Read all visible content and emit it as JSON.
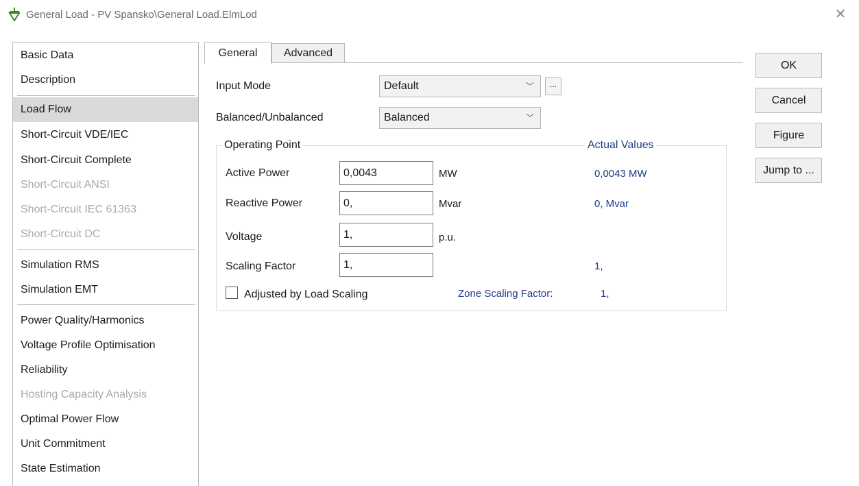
{
  "window": {
    "title": "General Load - PV Spansko\\General Load.ElmLod",
    "close_glyph": "✕",
    "icon": "load-arrow-icon",
    "icon_color": "#3a8a2a"
  },
  "nav": {
    "items": [
      {
        "label": "Basic Data",
        "state": "normal"
      },
      {
        "label": "Description",
        "state": "normal"
      },
      {
        "label": "Load Flow",
        "state": "selected"
      },
      {
        "label": "Short-Circuit VDE/IEC",
        "state": "normal"
      },
      {
        "label": "Short-Circuit Complete",
        "state": "normal"
      },
      {
        "label": "Short-Circuit ANSI",
        "state": "disabled"
      },
      {
        "label": "Short-Circuit IEC 61363",
        "state": "disabled"
      },
      {
        "label": "Short-Circuit DC",
        "state": "disabled"
      },
      {
        "label": "Simulation RMS",
        "state": "normal"
      },
      {
        "label": "Simulation EMT",
        "state": "normal"
      },
      {
        "label": "Power Quality/Harmonics",
        "state": "normal"
      },
      {
        "label": "Voltage Profile Optimisation",
        "state": "normal"
      },
      {
        "label": "Reliability",
        "state": "normal"
      },
      {
        "label": "Hosting Capacity Analysis",
        "state": "disabled"
      },
      {
        "label": "Optimal Power Flow",
        "state": "normal"
      },
      {
        "label": "Unit Commitment",
        "state": "normal"
      },
      {
        "label": "State Estimation",
        "state": "normal"
      }
    ]
  },
  "tabs": [
    {
      "label": "General",
      "active": true
    },
    {
      "label": "Advanced",
      "active": false
    }
  ],
  "form": {
    "input_mode": {
      "label": "Input Mode",
      "value": "Default",
      "dots": "..."
    },
    "balanced": {
      "label": "Balanced/Unbalanced",
      "value": "Balanced"
    },
    "chevron": "﹀"
  },
  "operating_point": {
    "title": "Operating Point",
    "actual_title": "Actual Values",
    "rows": [
      {
        "label": "Active Power",
        "value": "0,0043",
        "unit": "MW",
        "actual": "0,0043 MW"
      },
      {
        "label": "Reactive Power",
        "value": "0,",
        "unit": "Mvar",
        "actual": "0, Mvar"
      },
      {
        "label": "Voltage",
        "value": "1,",
        "unit": "p.u.",
        "actual": ""
      },
      {
        "label": "Scaling Factor",
        "value": "1,",
        "unit": "",
        "actual": "1,"
      }
    ],
    "adjusted_label": "Adjusted by Load Scaling",
    "adjusted_checked": false,
    "zone_label": "Zone Scaling Factor:",
    "zone_value": "1,"
  },
  "buttons": {
    "ok": "OK",
    "cancel": "Cancel",
    "figure": "Figure",
    "jump": "Jump to ..."
  },
  "colors": {
    "accent_blue": "#1f3d8a",
    "selected_bg": "#d9d9d9",
    "disabled_text": "#a9a9a9"
  }
}
